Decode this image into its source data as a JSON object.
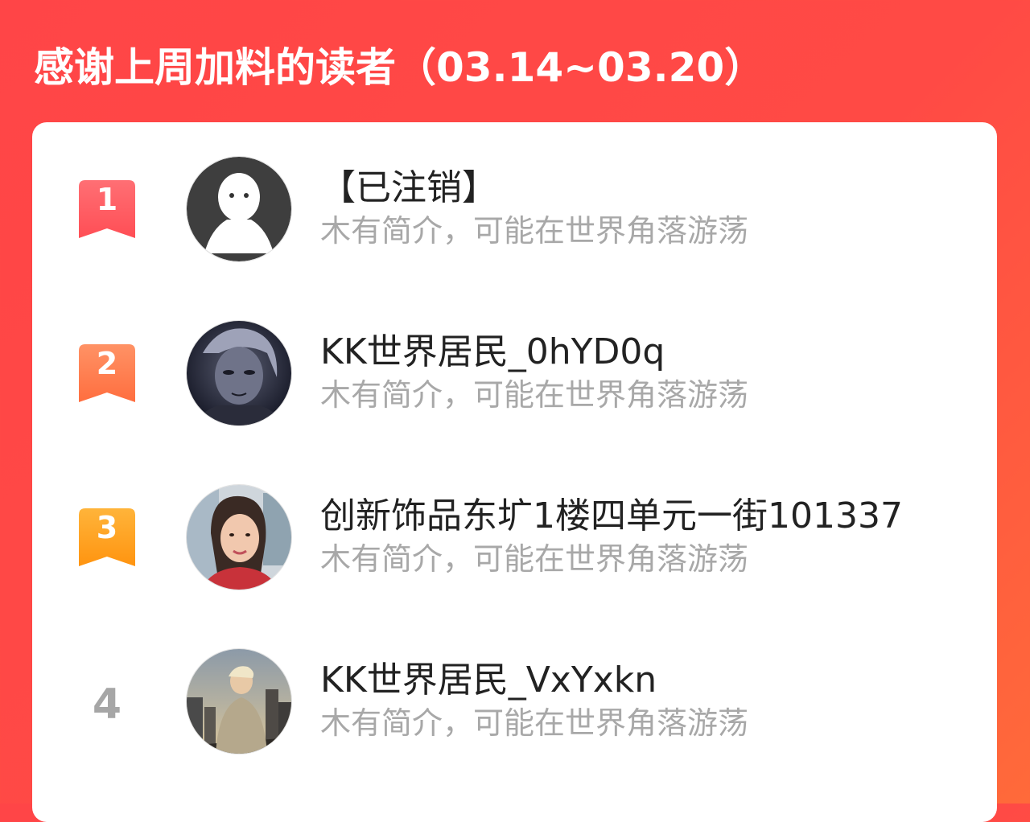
{
  "title": "感谢上周加料的读者（03.14~03.20）",
  "readers": [
    {
      "rank": "1",
      "name": "【已注销】",
      "bio": "木有简介，可能在世界角落游荡",
      "avatar": "default-ghost-avatar",
      "badge_color": "#ff5a60"
    },
    {
      "rank": "2",
      "name": "KK世界居民_0hYD0q",
      "bio": "木有简介，可能在世界角落游荡",
      "avatar": "anime-character-avatar",
      "badge_color": "#ff7a4a"
    },
    {
      "rank": "3",
      "name": "创新饰品东圹1楼四单元一街101337",
      "bio": "木有简介，可能在世界角落游荡",
      "avatar": "woman-photo-avatar",
      "badge_color": "#ffa21c"
    },
    {
      "rank": "4",
      "name": "KK世界居民_VxYxkn",
      "bio": "木有简介，可能在世界角落游荡",
      "avatar": "city-photo-avatar",
      "badge_color": "#a6a6a6"
    }
  ]
}
